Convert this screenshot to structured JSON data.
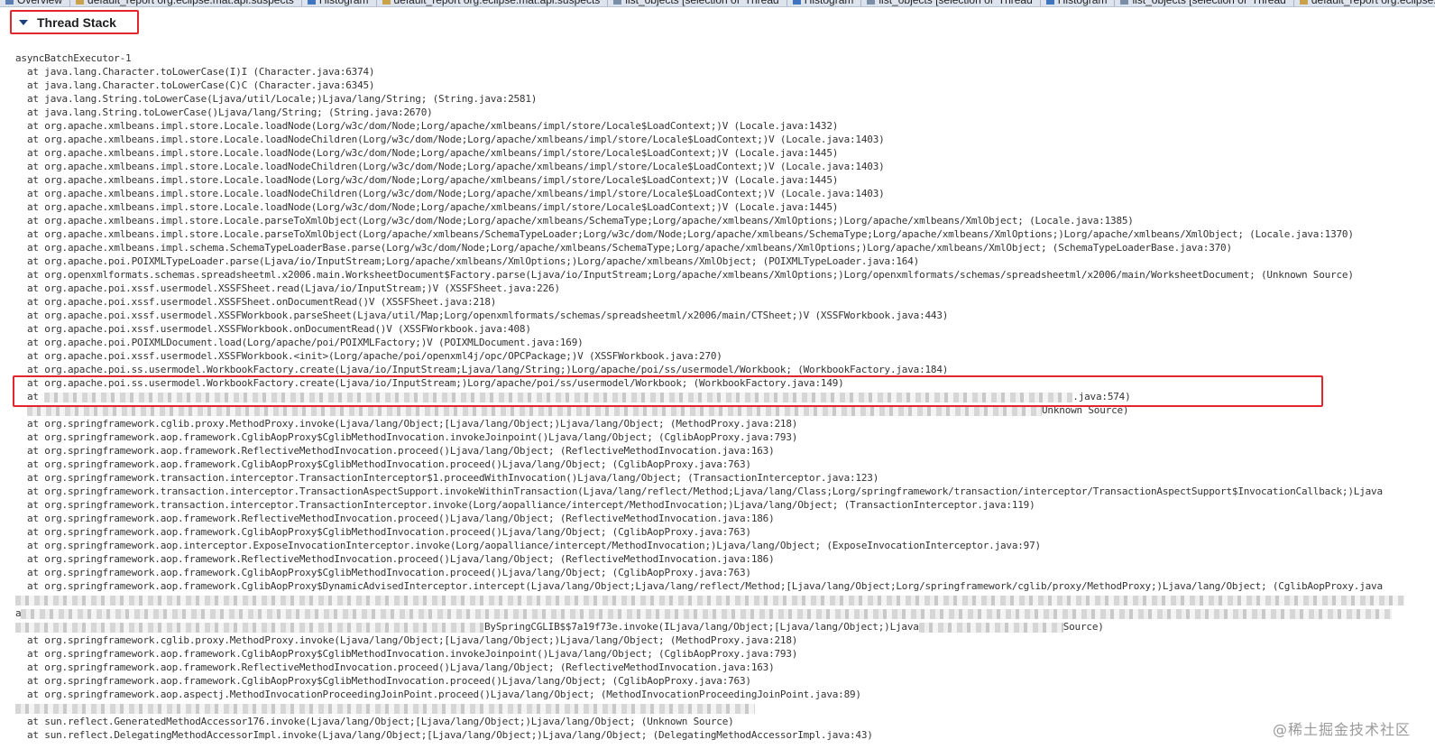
{
  "tabs": [
    {
      "label": "Overview",
      "icon": "overview-icon"
    },
    {
      "label": "default_report  org.eclipse.mat.api:suspects",
      "icon": "report-icon"
    },
    {
      "label": "Histogram",
      "icon": "histogram-icon"
    },
    {
      "label": "default_report  org.eclipse.mat.api:suspects",
      "icon": "report-icon"
    },
    {
      "label": "list_objects  [selection of 'Thread",
      "icon": "list-icon"
    },
    {
      "label": "Histogram",
      "icon": "histogram-icon"
    },
    {
      "label": "list_objects  [selection of 'Thread",
      "icon": "list-icon"
    },
    {
      "label": "Histogram",
      "icon": "histogram-icon"
    },
    {
      "label": "list_objects  [selection of 'Thread",
      "icon": "list-icon"
    },
    {
      "label": "default_report  org.eclipse.mat.api:suspects",
      "icon": "report-icon"
    }
  ],
  "section": {
    "title": "Thread Stack",
    "icon": "collapse-triangle-icon"
  },
  "thread_name": "asyncBatchExecutor-1",
  "frames_a": [
    "at java.lang.Character.toLowerCase(I)I (Character.java:6374)",
    "at java.lang.Character.toLowerCase(C)C (Character.java:6345)",
    "at java.lang.String.toLowerCase(Ljava/util/Locale;)Ljava/lang/String; (String.java:2581)",
    "at java.lang.String.toLowerCase()Ljava/lang/String; (String.java:2670)",
    "at org.apache.xmlbeans.impl.store.Locale.loadNode(Lorg/w3c/dom/Node;Lorg/apache/xmlbeans/impl/store/Locale$LoadContext;)V (Locale.java:1432)",
    "at org.apache.xmlbeans.impl.store.Locale.loadNodeChildren(Lorg/w3c/dom/Node;Lorg/apache/xmlbeans/impl/store/Locale$LoadContext;)V (Locale.java:1403)",
    "at org.apache.xmlbeans.impl.store.Locale.loadNode(Lorg/w3c/dom/Node;Lorg/apache/xmlbeans/impl/store/Locale$LoadContext;)V (Locale.java:1445)",
    "at org.apache.xmlbeans.impl.store.Locale.loadNodeChildren(Lorg/w3c/dom/Node;Lorg/apache/xmlbeans/impl/store/Locale$LoadContext;)V (Locale.java:1403)",
    "at org.apache.xmlbeans.impl.store.Locale.loadNode(Lorg/w3c/dom/Node;Lorg/apache/xmlbeans/impl/store/Locale$LoadContext;)V (Locale.java:1445)",
    "at org.apache.xmlbeans.impl.store.Locale.loadNodeChildren(Lorg/w3c/dom/Node;Lorg/apache/xmlbeans/impl/store/Locale$LoadContext;)V (Locale.java:1403)",
    "at org.apache.xmlbeans.impl.store.Locale.loadNode(Lorg/w3c/dom/Node;Lorg/apache/xmlbeans/impl/store/Locale$LoadContext;)V (Locale.java:1445)",
    "at org.apache.xmlbeans.impl.store.Locale.parseToXmlObject(Lorg/w3c/dom/Node;Lorg/apache/xmlbeans/SchemaType;Lorg/apache/xmlbeans/XmlOptions;)Lorg/apache/xmlbeans/XmlObject; (Locale.java:1385)",
    "at org.apache.xmlbeans.impl.store.Locale.parseToXmlObject(Lorg/apache/xmlbeans/SchemaTypeLoader;Lorg/w3c/dom/Node;Lorg/apache/xmlbeans/SchemaType;Lorg/apache/xmlbeans/XmlOptions;)Lorg/apache/xmlbeans/XmlObject; (Locale.java:1370)",
    "at org.apache.xmlbeans.impl.schema.SchemaTypeLoaderBase.parse(Lorg/w3c/dom/Node;Lorg/apache/xmlbeans/SchemaType;Lorg/apache/xmlbeans/XmlOptions;)Lorg/apache/xmlbeans/XmlObject; (SchemaTypeLoaderBase.java:370)",
    "at org.apache.poi.POIXMLTypeLoader.parse(Ljava/io/InputStream;Lorg/apache/xmlbeans/XmlOptions;)Lorg/apache/xmlbeans/XmlObject; (POIXMLTypeLoader.java:164)",
    "at org.openxmlformats.schemas.spreadsheetml.x2006.main.WorksheetDocument$Factory.parse(Ljava/io/InputStream;Lorg/apache/xmlbeans/XmlOptions;)Lorg/openxmlformats/schemas/spreadsheetml/x2006/main/WorksheetDocument; (Unknown Source)",
    "at org.apache.poi.xssf.usermodel.XSSFSheet.read(Ljava/io/InputStream;)V (XSSFSheet.java:226)",
    "at org.apache.poi.xssf.usermodel.XSSFSheet.onDocumentRead()V (XSSFSheet.java:218)",
    "at org.apache.poi.xssf.usermodel.XSSFWorkbook.parseSheet(Ljava/util/Map;Lorg/openxmlformats/schemas/spreadsheetml/x2006/main/CTSheet;)V (XSSFWorkbook.java:443)",
    "at org.apache.poi.xssf.usermodel.XSSFWorkbook.onDocumentRead()V (XSSFWorkbook.java:408)",
    "at org.apache.poi.POIXMLDocument.load(Lorg/apache/poi/POIXMLFactory;)V (POIXMLDocument.java:169)",
    "at org.apache.poi.xssf.usermodel.XSSFWorkbook.<init>(Lorg/apache/poi/openxml4j/opc/OPCPackage;)V (XSSFWorkbook.java:270)",
    "at org.apache.poi.ss.usermodel.WorkbookFactory.create(Ljava/io/InputStream;Ljava/lang/String;)Lorg/apache/poi/ss/usermodel/Workbook; (WorkbookFactory.java:184)",
    "at org.apache.poi.ss.usermodel.WorkbookFactory.create(Ljava/io/InputStream;)Lorg/apache/poi/ss/usermodel/Workbook; (WorkbookFactory.java:149)"
  ],
  "partial_frame_1": {
    "prefix": "at ",
    "suffix": ".java:574)"
  },
  "partial_frame_2": {
    "suffix": "Unknown Source)"
  },
  "frames_b": [
    "at org.springframework.cglib.proxy.MethodProxy.invoke(Ljava/lang/Object;[Ljava/lang/Object;)Ljava/lang/Object; (MethodProxy.java:218)",
    "at org.springframework.aop.framework.CglibAopProxy$CglibMethodInvocation.invokeJoinpoint()Ljava/lang/Object; (CglibAopProxy.java:793)",
    "at org.springframework.aop.framework.ReflectiveMethodInvocation.proceed()Ljava/lang/Object; (ReflectiveMethodInvocation.java:163)",
    "at org.springframework.aop.framework.CglibAopProxy$CglibMethodInvocation.proceed()Ljava/lang/Object; (CglibAopProxy.java:763)",
    "at org.springframework.transaction.interceptor.TransactionInterceptor$1.proceedWithInvocation()Ljava/lang/Object; (TransactionInterceptor.java:123)",
    "at org.springframework.transaction.interceptor.TransactionAspectSupport.invokeWithinTransaction(Ljava/lang/reflect/Method;Ljava/lang/Class;Lorg/springframework/transaction/interceptor/TransactionAspectSupport$InvocationCallback;)Ljava",
    "at org.springframework.transaction.interceptor.TransactionInterceptor.invoke(Lorg/aopalliance/intercept/MethodInvocation;)Ljava/lang/Object; (TransactionInterceptor.java:119)",
    "at org.springframework.aop.framework.ReflectiveMethodInvocation.proceed()Ljava/lang/Object; (ReflectiveMethodInvocation.java:186)",
    "at org.springframework.aop.framework.CglibAopProxy$CglibMethodInvocation.proceed()Ljava/lang/Object; (CglibAopProxy.java:763)",
    "at org.springframework.aop.interceptor.ExposeInvocationInterceptor.invoke(Lorg/aopalliance/intercept/MethodInvocation;)Ljava/lang/Object; (ExposeInvocationInterceptor.java:97)",
    "at org.springframework.aop.framework.ReflectiveMethodInvocation.proceed()Ljava/lang/Object; (ReflectiveMethodInvocation.java:186)",
    "at org.springframework.aop.framework.CglibAopProxy$CglibMethodInvocation.proceed()Ljava/lang/Object; (CglibAopProxy.java:763)",
    "at org.springframework.aop.framework.CglibAopProxy$DynamicAdvisedInterceptor.intercept(Ljava/lang/Object;Ljava/lang/reflect/Method;[Ljava/lang/Object;Lorg/springframework/cglib/proxy/MethodProxy;)Ljava/lang/Object; (CglibAopProxy.java"
  ],
  "partial_frame_3": {
    "prefix": "a"
  },
  "partial_frame_4": {
    "text": "BySpringCGLIB$$7a19f73e.invoke(ILjava/lang/Object;[Ljava/lang/Object;)Ljava",
    "suffix": "Source)"
  },
  "frames_c": [
    "at org.springframework.cglib.proxy.MethodProxy.invoke(Ljava/lang/Object;[Ljava/lang/Object;)Ljava/lang/Object; (MethodProxy.java:218)",
    "at org.springframework.aop.framework.CglibAopProxy$CglibMethodInvocation.invokeJoinpoint()Ljava/lang/Object; (CglibAopProxy.java:793)",
    "at org.springframework.aop.framework.ReflectiveMethodInvocation.proceed()Ljava/lang/Object; (ReflectiveMethodInvocation.java:163)",
    "at org.springframework.aop.framework.CglibAopProxy$CglibMethodInvocation.proceed()Ljava/lang/Object; (CglibAopProxy.java:763)",
    "at org.springframework.aop.aspectj.MethodInvocationProceedingJoinPoint.proceed()Ljava/lang/Object; (MethodInvocationProceedingJoinPoint.java:89)"
  ],
  "frames_d": [
    "at sun.reflect.GeneratedMethodAccessor176.invoke(Ljava/lang/Object;[Ljava/lang/Object;)Ljava/lang/Object; (Unknown Source)",
    "at sun.reflect.DelegatingMethodAccessorImpl.invoke(Ljava/lang/Object;[Ljava/lang/Object;)Ljava/lang/Object; (DelegatingMethodAccessorImpl.java:43)"
  ],
  "watermark": "@稀土掘金技术社区",
  "colors": {
    "highlight_border": "#e3262b",
    "text": "#333333"
  }
}
